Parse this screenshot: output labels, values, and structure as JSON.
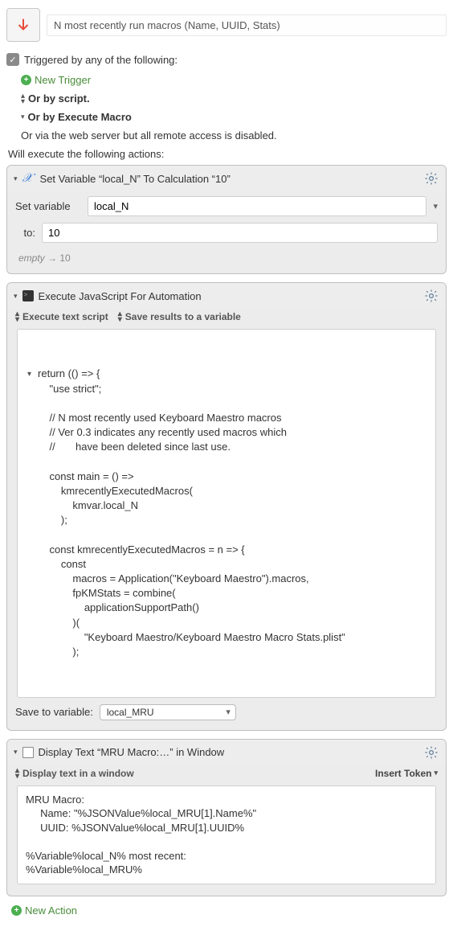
{
  "macro_title": "N most recently run macros (Name, UUID, Stats)",
  "triggered_label": "Triggered by any of the following:",
  "new_trigger_label": "New Trigger",
  "or_script": "Or by script.",
  "or_execute_macro": "Or by Execute Macro",
  "or_web": "Or via the web server but all remote access is disabled.",
  "actions_label": "Will execute the following actions:",
  "action1": {
    "title": "Set Variable “local_N” To Calculation “10”",
    "set_variable_label": "Set variable",
    "variable_name": "local_N",
    "to_label": "to:",
    "to_value": "10",
    "result_empty": "empty",
    "result_arrow": "→ 10"
  },
  "action2": {
    "title": "Execute JavaScript For Automation",
    "opt1": "Execute text script",
    "opt2": "Save results to a variable",
    "code": "return (() => {\n    \"use strict\";\n\n    // N most recently used Keyboard Maestro macros\n    // Ver 0.3 indicates any recently used macros which\n    //       have been deleted since last use.\n\n    const main = () =>\n        kmrecentlyExecutedMacros(\n            kmvar.local_N\n        );\n\n    const kmrecentlyExecutedMacros = n => {\n        const\n            macros = Application(\"Keyboard Maestro\").macros,\n            fpKMStats = combine(\n                applicationSupportPath()\n            )(\n                \"Keyboard Maestro/Keyboard Maestro Macro Stats.plist\"\n            );",
    "save_to_label": "Save to variable:",
    "save_to_value": "local_MRU"
  },
  "action3": {
    "title": "Display Text “MRU Macro:…” in Window",
    "opt1": "Display text in a window",
    "insert_token": "Insert Token",
    "text": "MRU Macro:\n     Name: \"%JSONValue%local_MRU[1].Name%\"\n     UUID: %JSONValue%local_MRU[1].UUID%\n\n%Variable%local_N% most recent:\n%Variable%local_MRU%"
  },
  "new_action_label": "New Action"
}
